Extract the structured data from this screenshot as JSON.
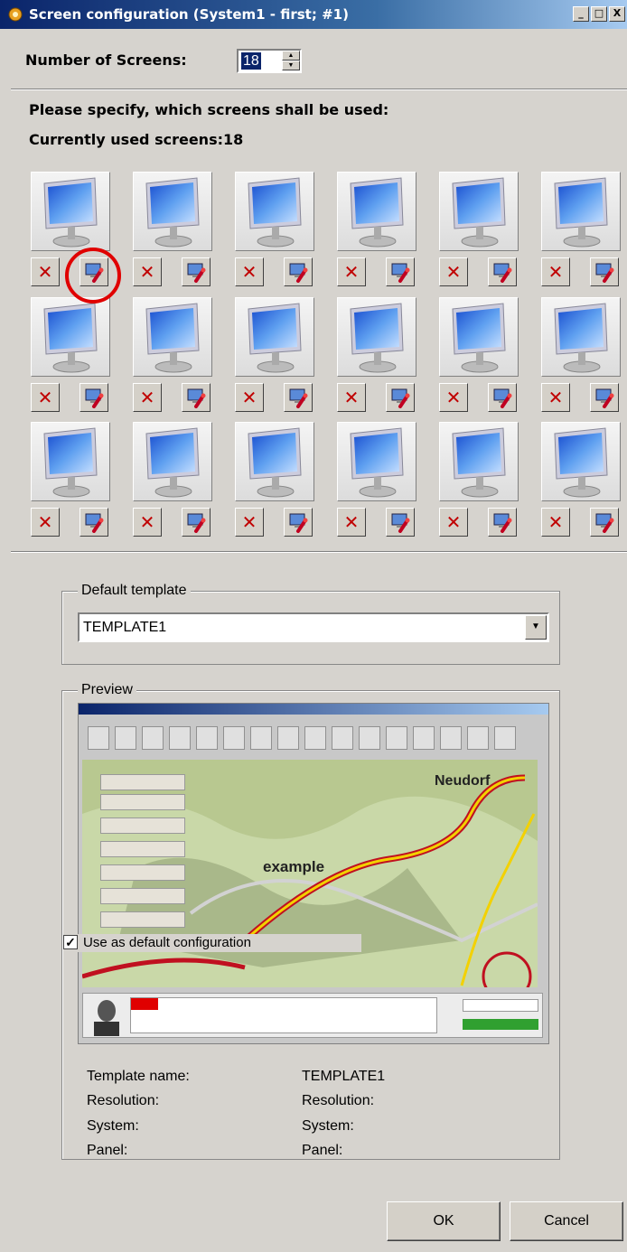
{
  "window": {
    "title": "Screen configuration (System1 - first; #1)",
    "minimize": "_",
    "maximize": "□",
    "close": "X"
  },
  "screens": {
    "count_label": "Number of Screens:",
    "count_value": "18",
    "instruction": "Please specify, which screens shall be used:",
    "currently_used": "Currently used screens:18",
    "remove_glyph": "✕"
  },
  "default_template": {
    "group_label": "Default template",
    "selected": "TEMPLATE1"
  },
  "preview": {
    "group_label": "Preview",
    "map_label_city": "Neudorf",
    "map_label_example": "example",
    "side_menu": [
      "",
      "",
      "",
      "",
      "",
      "",
      ""
    ],
    "use_default_label": "Use as default configuration",
    "use_default_checked": true
  },
  "info": {
    "template_name_label": "Template name:",
    "template_name_value": "TEMPLATE1",
    "resolution_label": "Resolution:",
    "resolution_value": "Resolution:",
    "system_label": "System:",
    "system_value": "System:",
    "panel_label": "Panel:",
    "panel_value": "Panel:"
  },
  "buttons": {
    "ok": "OK",
    "cancel": "Cancel"
  },
  "colors": {
    "titlebar": "#0a246a",
    "highlight_circle": "#e00000",
    "remove_x": "#c00000",
    "dialog_bg": "#d6d3ce"
  }
}
